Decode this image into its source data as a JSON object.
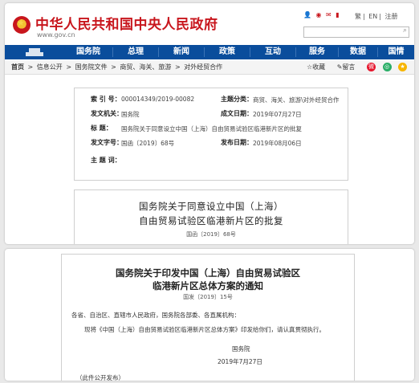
{
  "header": {
    "site_title": "中华人民共和国中央人民政府",
    "site_url": "www.gov.cn",
    "top_icons": [
      "登录",
      "新浪微博",
      "微信",
      "移动客户端",
      "国务院客户端"
    ],
    "top_links": [
      "繁",
      "EN",
      "注册"
    ],
    "search_placeholder": ""
  },
  "nav": {
    "items": [
      "首页",
      "国务院",
      "总理",
      "新闻",
      "政策",
      "互动",
      "服务",
      "数据",
      "国情"
    ]
  },
  "breadcrumb": {
    "items": [
      "首页",
      ">",
      "信息公开",
      ">",
      "国务院文件",
      ">",
      "商贸、海关、旅游",
      ">",
      "对外经贸合作"
    ],
    "tools": [
      "收藏",
      "留言"
    ],
    "share_icons": [
      "weibo-icon",
      "wechat-icon",
      "qzone-icon"
    ]
  },
  "info_table": {
    "index_label": "索 引 号：",
    "index_value": "000014349/2019-00082",
    "category_label": "主题分类：",
    "category_value": "商贸、海关、旅游\\对外经贸合作",
    "issuer_label": "发文机关：",
    "issuer_value": "国务院",
    "written_label": "成文日期：",
    "written_value": "2019年07月27日",
    "title_label": "标 题：",
    "title_value": "国务院关于同意设立中国（上海）自由贸易试验区临港新片区的批复",
    "docno_label": "发文字号：",
    "docno_value": "国函〔2019〕68号",
    "published_label": "发布日期：",
    "published_value": "2019年08月06日",
    "topic_label": "主 题 词：",
    "topic_value": ""
  },
  "doc1": {
    "title_line1": "国务院关于同意设立中国（上海）",
    "title_line2": "自由贸易试验区临港新片区的批复",
    "doc_number": "国函〔2019〕68号"
  },
  "doc2": {
    "title_line1": "国务院关于印发中国（上海）自由贸易试验区",
    "title_line2": "临港新片区总体方案的通知",
    "doc_number": "国发〔2019〕15号",
    "salutation": "各省、自治区、直辖市人民政府，国务院各部委、各直属机构：",
    "body": "现将《中国（上海）自由贸易试验区临港新片区总体方案》印发给你们，请认真贯彻执行。",
    "signer": "国务院",
    "date": "2019年7月27日",
    "footer_note": "（此件公开发布）"
  },
  "colors": {
    "brand_red": "#c8161d",
    "nav_blue": "#0a4d9c"
  }
}
